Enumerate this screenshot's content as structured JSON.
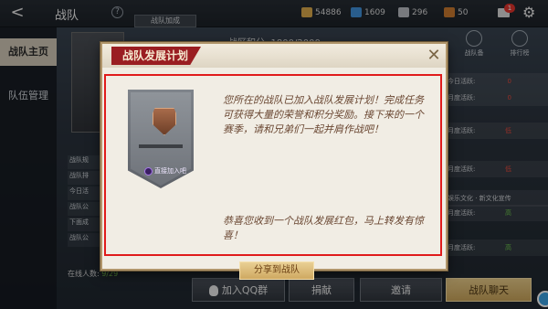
{
  "topbar": {
    "back_label": "<",
    "title": "战队",
    "help": "?",
    "resources": [
      {
        "name": "gold-coin",
        "value": "54886",
        "color": "#d9a84a"
      },
      {
        "name": "blue-coin",
        "value": "1609",
        "color": "#3f8fd8"
      },
      {
        "name": "silver-coin",
        "value": "296",
        "color": "#b8bcc2"
      },
      {
        "name": "bronze-coin",
        "value": "50",
        "color": "#c8782f"
      }
    ],
    "mail_badge": "1"
  },
  "sidebar": {
    "items": [
      {
        "label": "战队主页",
        "active": true
      },
      {
        "label": "队伍管理",
        "active": false
      }
    ]
  },
  "background": {
    "tab_tag": "战队加成",
    "points": "战区积分: 1800/2000",
    "left_list": [
      "战队规",
      "战队排",
      "今日活",
      "战队公",
      "下面成",
      "战队公"
    ],
    "online_label": "在线人数:",
    "online_value": "9/29",
    "right_icons": [
      "战队备",
      "排行榜"
    ],
    "right_list": [
      {
        "label": "今日活跃:",
        "value": "0",
        "state": "red"
      },
      {
        "label": "月度活跃:",
        "value": "0",
        "state": "red"
      },
      {
        "label": "月度活跃:",
        "value": "低",
        "state": "red"
      },
      {
        "label": "月度活跃:",
        "value": "低",
        "state": "red"
      },
      {
        "label": "月度活跃:",
        "value": "高",
        "state": "green"
      },
      {
        "label": "月度活跃:",
        "value": "高",
        "state": "green"
      }
    ],
    "right_extra": "娱乐文化 · 新文化宣传"
  },
  "bottom": {
    "qq": "加入QQ群",
    "donate": "捐献",
    "invite": "邀请",
    "chat": "战队聊天"
  },
  "dialog": {
    "title": "战队发展计划",
    "close": "✕",
    "badge_join": "直接加入吧",
    "message": "您所在的战队已加入战队发展计划！完成任务可获得大量的荣誉和积分奖励。接下来的一个赛季，请和兄弟们一起并肩作战吧！",
    "message2": "恭喜您收到一个战队发展红包，马上转发有惊喜！",
    "share": "分享到战队"
  }
}
